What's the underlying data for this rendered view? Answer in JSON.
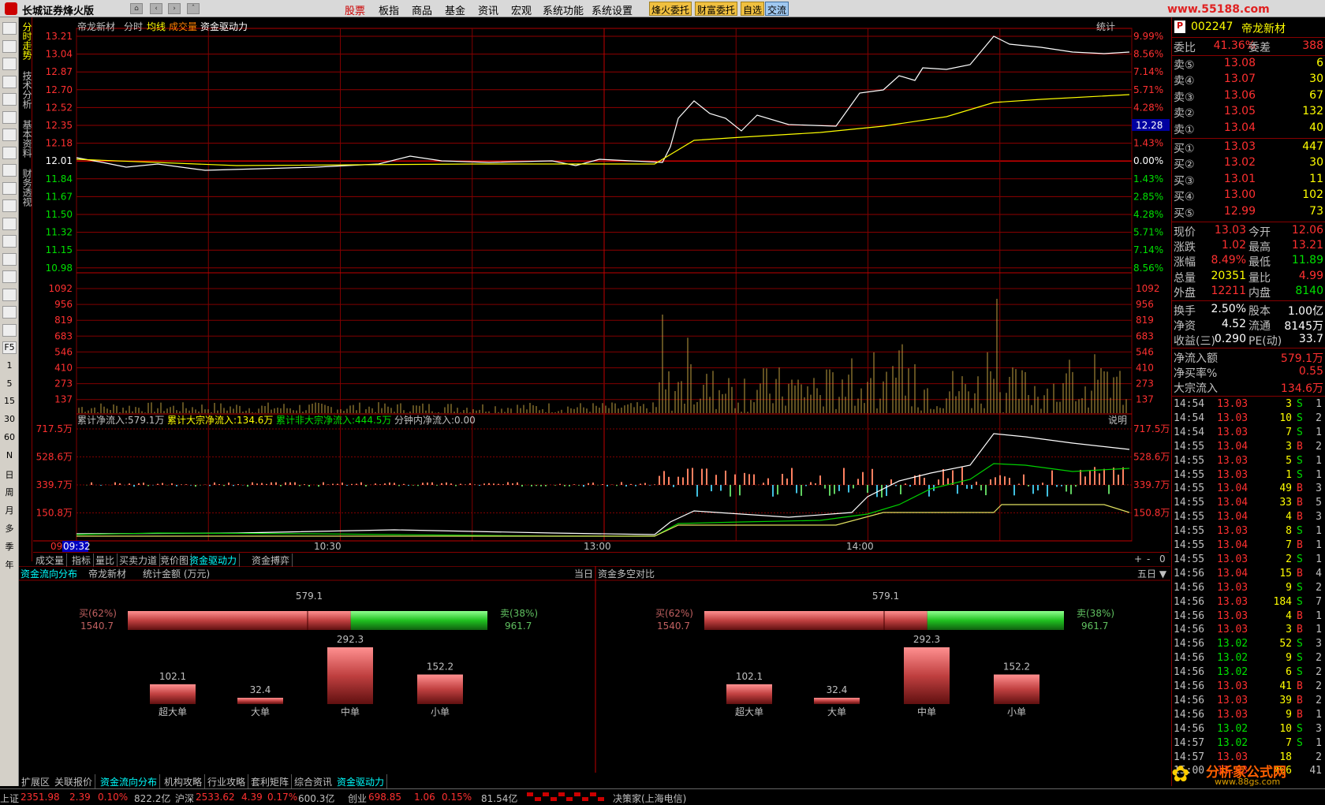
{
  "title": "长城证券烽火版",
  "menus": [
    "股票",
    "板指",
    "商品",
    "基金",
    "资讯",
    "宏观",
    "系统功能",
    "系统设置"
  ],
  "tool_buttons": [
    "烽火委托",
    "财富委托",
    "自选",
    "交流"
  ],
  "watermark_top": "www.55188.com",
  "vtabs": [
    "分时走势",
    "技术分析",
    "基本资料",
    "财务透视"
  ],
  "left_nums": [
    "F5",
    "1",
    "5",
    "15",
    "30",
    "60",
    "N",
    "日",
    "周",
    "月",
    "多",
    "季",
    "年"
  ],
  "chart_header": {
    "name": "帝龙新材",
    "a": "分时",
    "b": "均线",
    "c": "成交量",
    "d": "资金驱动力",
    "stat": "统计"
  },
  "price_axis": [
    "13.21",
    "13.04",
    "12.87",
    "12.70",
    "12.52",
    "12.35",
    "12.18",
    "12.01",
    "11.84",
    "11.67",
    "11.50",
    "11.32",
    "11.15",
    "10.98"
  ],
  "pct_axis": [
    "9.99%",
    "8.56%",
    "7.14%",
    "5.71%",
    "4.28%",
    "2.85%",
    "1.43%",
    "0.00%",
    "1.43%",
    "2.85%",
    "4.28%",
    "5.71%",
    "7.14%",
    "8.56%"
  ],
  "last_price_tag": "12.28",
  "vol_axis": [
    "1092",
    "956",
    "819",
    "683",
    "546",
    "410",
    "273",
    "137"
  ],
  "flow_header": {
    "a": "累计净流入:579.1万",
    "b": "累计大宗净流入:134.6万",
    "c": "累计非大宗净流入:444.5万",
    "d": "分钟内净流入:0.00",
    "e": "说明"
  },
  "flow_axis": [
    "717.5万",
    "528.6万",
    "339.7万",
    "150.8万"
  ],
  "time_labels": [
    "09",
    "09:32",
    "10:30",
    "13:00",
    "14:00"
  ],
  "sub_tabs": [
    "成交量",
    "指标",
    "量比",
    "买卖力道",
    "竞价图",
    "资金驱动力",
    "资金搏弈"
  ],
  "sub_tab_ctrls": [
    "+",
    "-",
    "0"
  ],
  "panel_left": {
    "title": "资金流向分布",
    "name": "帝龙新材",
    "unit": "统计金额 (万元)",
    "period": "当日"
  },
  "panel_right": {
    "title": "资金多空对比",
    "period": "五日 ▼"
  },
  "buysell": {
    "net": "579.1",
    "buy_label": "买(62%)",
    "buy_val": "1540.7",
    "sell_label": "卖(38%)",
    "sell_val": "961.7"
  },
  "bars": [
    {
      "label": "超大单",
      "value": 102.1
    },
    {
      "label": "大单",
      "value": 32.4
    },
    {
      "label": "中单",
      "value": 292.3
    },
    {
      "label": "小单",
      "value": 152.2
    }
  ],
  "quote": {
    "code": "002247",
    "name": "帝龙新材",
    "wb_label": "委比",
    "wb": "41.36%",
    "wc_label": "委差",
    "wc": "388",
    "sells": [
      [
        "卖⑤",
        "13.08",
        "6"
      ],
      [
        "卖④",
        "13.07",
        "30"
      ],
      [
        "卖③",
        "13.06",
        "67"
      ],
      [
        "卖②",
        "13.05",
        "132"
      ],
      [
        "卖①",
        "13.04",
        "40"
      ]
    ],
    "buys": [
      [
        "买①",
        "13.03",
        "447"
      ],
      [
        "买②",
        "13.02",
        "30"
      ],
      [
        "买③",
        "13.01",
        "11"
      ],
      [
        "买④",
        "13.00",
        "102"
      ],
      [
        "买⑤",
        "12.99",
        "73"
      ]
    ],
    "stats": [
      [
        "现价",
        "13.03",
        "今开",
        "12.06"
      ],
      [
        "涨跌",
        "1.02",
        "最高",
        "13.21"
      ],
      [
        "涨幅",
        "8.49%",
        "最低",
        "11.89"
      ],
      [
        "总量",
        "20351",
        "量比",
        "4.99"
      ],
      [
        "外盘",
        "12211",
        "内盘",
        "8140"
      ]
    ],
    "fund": [
      [
        "换手",
        "2.50%",
        "股本",
        "1.00亿"
      ],
      [
        "净资",
        "4.52",
        "流通",
        "8145万"
      ],
      [
        "收益(三)",
        "0.290",
        "PE(动)",
        "33.7"
      ]
    ],
    "flow": [
      [
        "净流入额",
        "579.1万"
      ],
      [
        "净买率%",
        "0.55"
      ],
      [
        "大宗流入",
        "134.6万"
      ]
    ]
  },
  "ticks": [
    [
      "14:54",
      "13.03",
      "3",
      "S",
      "1"
    ],
    [
      "14:54",
      "13.03",
      "10",
      "S",
      "2"
    ],
    [
      "14:54",
      "13.03",
      "7",
      "S",
      "1"
    ],
    [
      "14:55",
      "13.04",
      "3",
      "B",
      "2"
    ],
    [
      "14:55",
      "13.03",
      "5",
      "S",
      "1"
    ],
    [
      "14:55",
      "13.03",
      "1",
      "S",
      "1"
    ],
    [
      "14:55",
      "13.04",
      "49",
      "B",
      "3"
    ],
    [
      "14:55",
      "13.04",
      "33",
      "B",
      "5"
    ],
    [
      "14:55",
      "13.04",
      "4",
      "B",
      "3"
    ],
    [
      "14:55",
      "13.03",
      "8",
      "S",
      "1"
    ],
    [
      "14:55",
      "13.04",
      "7",
      "B",
      "1"
    ],
    [
      "14:55",
      "13.03",
      "2",
      "S",
      "1"
    ],
    [
      "14:56",
      "13.04",
      "15",
      "B",
      "4"
    ],
    [
      "14:56",
      "13.03",
      "9",
      "S",
      "2"
    ],
    [
      "14:56",
      "13.03",
      "184",
      "S",
      "7"
    ],
    [
      "14:56",
      "13.03",
      "4",
      "B",
      "1"
    ],
    [
      "14:56",
      "13.03",
      "3",
      "B",
      "1"
    ],
    [
      "14:56",
      "13.02",
      "52",
      "S",
      "3"
    ],
    [
      "14:56",
      "13.02",
      "9",
      "S",
      "2"
    ],
    [
      "14:56",
      "13.02",
      "6",
      "S",
      "2"
    ],
    [
      "14:56",
      "13.03",
      "41",
      "B",
      "2"
    ],
    [
      "14:56",
      "13.03",
      "39",
      "B",
      "2"
    ],
    [
      "14:56",
      "13.03",
      "9",
      "B",
      "1"
    ],
    [
      "14:56",
      "13.02",
      "10",
      "S",
      "3"
    ],
    [
      "14:57",
      "13.02",
      "7",
      "S",
      "1"
    ],
    [
      "14:57",
      "13.03",
      "18",
      "",
      "2"
    ],
    [
      "15:00",
      "13.03",
      "496",
      "",
      "41"
    ]
  ],
  "bottom_tabs": [
    "扩展区",
    "关联报价",
    "资金流向分布",
    "机构攻略",
    "行业攻略",
    "套利矩阵",
    "综合资讯",
    "资金驱动力"
  ],
  "status": [
    {
      "t": "上证",
      "c": "#c0c0c0"
    },
    {
      "t": "2351.98",
      "c": "#ff3030"
    },
    {
      "t": "2.39",
      "c": "#ff3030"
    },
    {
      "t": "0.10%",
      "c": "#ff3030"
    },
    {
      "t": "822.2亿",
      "c": "#c0c0c0"
    },
    {
      "t": "沪深",
      "c": "#c0c0c0"
    },
    {
      "t": "2533.62",
      "c": "#ff3030"
    },
    {
      "t": "4.39",
      "c": "#ff3030"
    },
    {
      "t": "0.17%",
      "c": "#ff3030"
    },
    {
      "t": "600.3亿",
      "c": "#c0c0c0"
    },
    {
      "t": "创业",
      "c": "#c0c0c0"
    },
    {
      "t": "698.85",
      "c": "#ff3030"
    },
    {
      "t": "1.06",
      "c": "#ff3030"
    },
    {
      "t": "0.15%",
      "c": "#ff3030"
    },
    {
      "t": "81.54亿",
      "c": "#c0c0c0"
    },
    {
      "t": "决策家(上海电信)",
      "c": "#c0c0c0"
    }
  ],
  "watermark_bottom": {
    "a": "分析家公式网",
    "b": "www.88gs.com"
  }
}
